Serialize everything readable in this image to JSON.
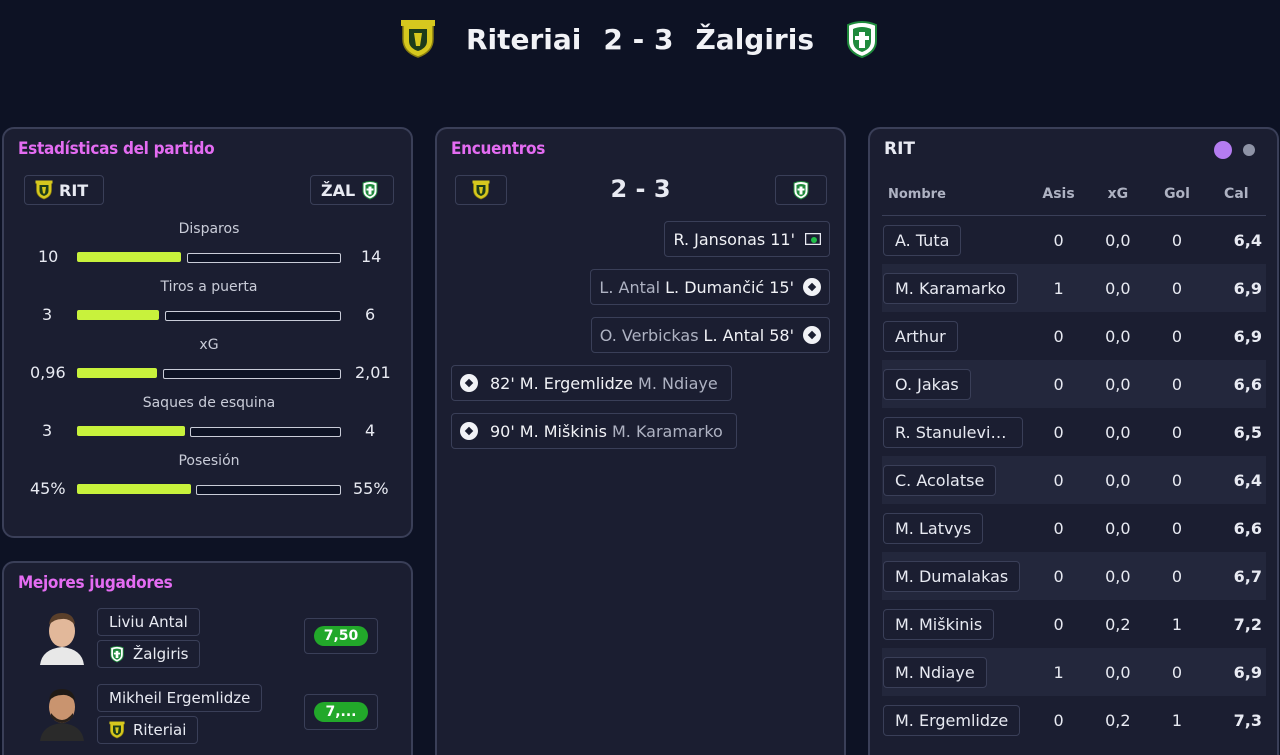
{
  "header": {
    "home": "Riteriai",
    "score": "2 - 3",
    "away": "Žalgiris"
  },
  "stats": {
    "title": "Estadísticas del partido",
    "home_abbr": "RIT",
    "away_abbr": "ŽAL",
    "rows": [
      {
        "label": "Disparos",
        "home": "10",
        "away": "14",
        "home_share": 0.42
      },
      {
        "label": "Tiros a puerta",
        "home": "3",
        "away": "6",
        "home_share": 0.33
      },
      {
        "label": "xG",
        "home": "0,96",
        "away": "2,01",
        "home_share": 0.32
      },
      {
        "label": "Saques de esquina",
        "home": "3",
        "away": "4",
        "home_share": 0.43
      },
      {
        "label": "Posesión",
        "home": "45%",
        "away": "55%",
        "home_share": 0.45
      }
    ]
  },
  "top_players": {
    "title": "Mejores jugadores",
    "players": [
      {
        "name": "Liviu Antal",
        "team": "Žalgiris",
        "rating": "7,50"
      },
      {
        "name": "Mikheil Ergemlidze",
        "team": "Riteriai",
        "rating": "7,..."
      }
    ]
  },
  "encounters": {
    "title": "Encuentros",
    "score": "2 - 3",
    "events": [
      {
        "muted": "",
        "main": "R. Jansonas",
        "minute": "11'",
        "icon": "card-icon"
      },
      {
        "muted": "L. Antal",
        "main": "L. Dumančić",
        "minute": "15'",
        "icon": "ball-icon"
      },
      {
        "muted": "O. Verbickas",
        "main": "L. Antal",
        "minute": "58'",
        "icon": "ball-icon"
      },
      {
        "muted": "M. Ndiaye",
        "main": "M. Ergemlidze",
        "minute": "82'",
        "icon": "ball-icon"
      },
      {
        "muted": "M. Karamarko",
        "main": "M. Miškinis",
        "minute": "90'",
        "icon": "ball-icon"
      }
    ]
  },
  "ratings": {
    "team": "RIT",
    "columns": [
      "Nombre",
      "Asis",
      "xG",
      "Gol",
      "Cal"
    ],
    "rows": [
      {
        "name": "A. Tuta",
        "asis": "0",
        "xg": "0,0",
        "gol": "0",
        "cal": "6,4"
      },
      {
        "name": "M. Karamarko",
        "asis": "1",
        "xg": "0,0",
        "gol": "0",
        "cal": "6,9"
      },
      {
        "name": "Arthur",
        "asis": "0",
        "xg": "0,0",
        "gol": "0",
        "cal": "6,9"
      },
      {
        "name": "O. Jakas",
        "asis": "0",
        "xg": "0,0",
        "gol": "0",
        "cal": "6,6"
      },
      {
        "name": "R. Stanulevičius",
        "asis": "0",
        "xg": "0,0",
        "gol": "0",
        "cal": "6,5"
      },
      {
        "name": "C. Acolatse",
        "asis": "0",
        "xg": "0,0",
        "gol": "0",
        "cal": "6,4"
      },
      {
        "name": "M. Latvys",
        "asis": "0",
        "xg": "0,0",
        "gol": "0",
        "cal": "6,6"
      },
      {
        "name": "M. Dumalakas",
        "asis": "0",
        "xg": "0,0",
        "gol": "0",
        "cal": "6,7"
      },
      {
        "name": "M. Miškinis",
        "asis": "0",
        "xg": "0,2",
        "gol": "1",
        "cal": "7,2"
      },
      {
        "name": "M. Ndiaye",
        "asis": "1",
        "xg": "0,0",
        "gol": "0",
        "cal": "6,9"
      },
      {
        "name": "M. Ergemlidze",
        "asis": "0",
        "xg": "0,2",
        "gol": "1",
        "cal": "7,3"
      }
    ]
  },
  "colors": {
    "accent_title": "#e46cf2",
    "bar_green": "#c8f23c",
    "rating_green": "#22a82a",
    "toggle_purple": "#b47cf0"
  }
}
